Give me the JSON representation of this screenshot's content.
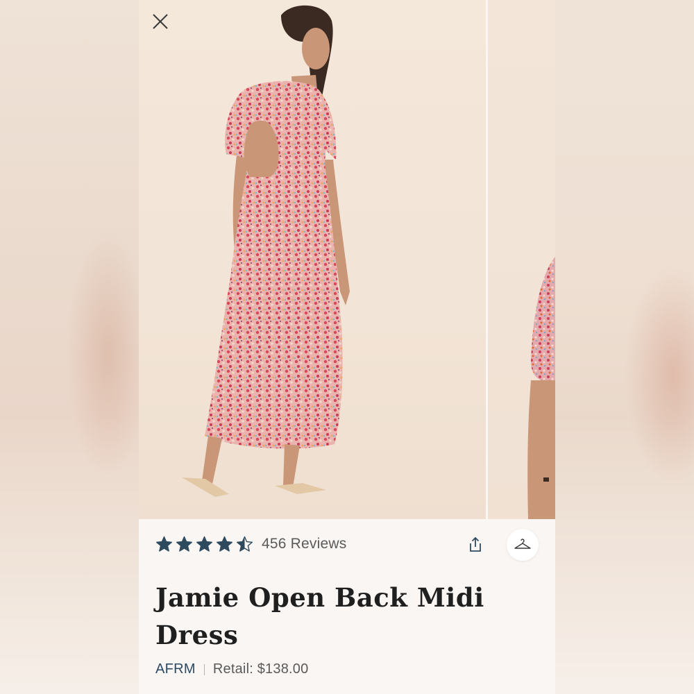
{
  "product": {
    "reviews_label": "456 Reviews",
    "rating": 4.5,
    "rating_max": 5,
    "title": "Jamie Open Back Midi Dress",
    "brand": "AFRM",
    "retail_label": "Retail: $138.00"
  },
  "icons": {
    "close": "close-icon",
    "share": "share-icon",
    "hanger": "hanger-icon",
    "star": "star-icon"
  },
  "colors": {
    "star": "#2e4a5e",
    "brand": "#2c4a63",
    "text_muted": "#5a5a5a",
    "title": "#1f1f1f",
    "panel_bg": "#faf6f3",
    "photo_bg": "#f3e7da"
  }
}
